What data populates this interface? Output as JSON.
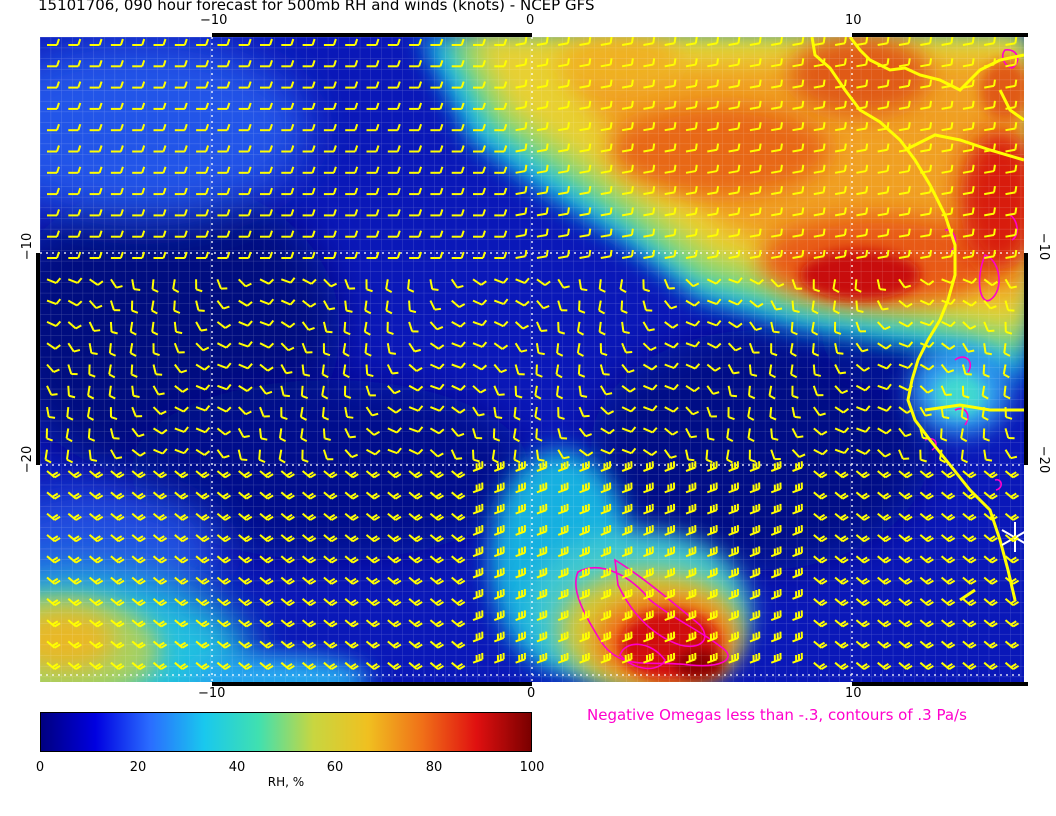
{
  "title": "15101706, 090 hour forecast for 500mb RH and winds (knots) - NCEP GFS",
  "axes": {
    "top_ticks": [
      "−10",
      "0",
      "10"
    ],
    "bottom_ticks": [
      "−10",
      "0",
      "10"
    ],
    "left_ticks": [
      "−10",
      "−20"
    ],
    "right_ticks": [
      "−10",
      "−20"
    ]
  },
  "omega_note": "Negative Omegas less than -.3, contours of .3 Pa/s",
  "colorbar": {
    "label": "RH, %",
    "ticks": [
      "0",
      "20",
      "40",
      "60",
      "80",
      "100"
    ],
    "colors": [
      "#000080",
      "#0000e0",
      "#2a6cff",
      "#19c8ee",
      "#40e0b0",
      "#c8d640",
      "#f0c020",
      "#f07018",
      "#e01010",
      "#7a0000"
    ]
  },
  "colors": {
    "wind_barbs": "#ffff00",
    "coastline": "#ffff00",
    "omega_contours": "#ff00cc",
    "grid": "#ffffff"
  },
  "chart_data": {
    "type": "heatmap",
    "title": "15101706, 090 hour forecast for 500mb RH and winds (knots) - NCEP GFS",
    "variable": "RH, %",
    "value_range": [
      0,
      100
    ],
    "lon_range": [
      -15.5,
      15.5
    ],
    "lat_range": [
      -29.5,
      0
    ],
    "lon_ticks": [
      -10,
      0,
      10
    ],
    "lat_ticks": [
      -10,
      -20
    ],
    "regions": [
      {
        "area": "north-east (0..15E, 0..-10)",
        "rh": "70-90"
      },
      {
        "area": "south-central (2..7E, -25..-30)",
        "rh": "80-95"
      },
      {
        "area": "south-west corner",
        "rh": "50-70"
      },
      {
        "area": "central/western ocean",
        "rh": "5-30"
      }
    ]
  }
}
